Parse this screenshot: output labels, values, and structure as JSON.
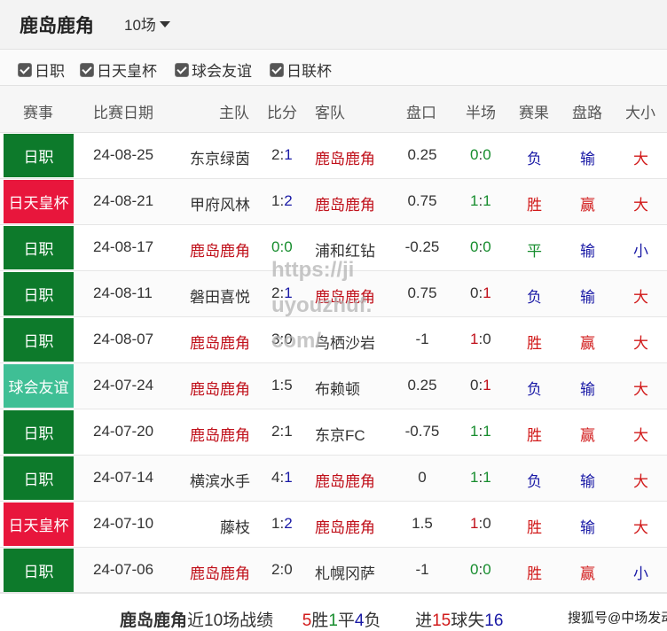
{
  "header": {
    "team": "鹿岛鹿角",
    "count": "10场"
  },
  "filters": [
    {
      "label": "日职",
      "checked": true
    },
    {
      "label": "日天皇杯",
      "checked": true
    },
    {
      "label": "球会友谊",
      "checked": true
    },
    {
      "label": "日联杯",
      "checked": true
    }
  ],
  "columns": [
    "赛事",
    "比赛日期",
    "主队",
    "比分",
    "客队",
    "盘口",
    "半场",
    "赛果",
    "盘路",
    "大小"
  ],
  "colors": {
    "j1": "#0d7a2b",
    "emperor": "#e8163c",
    "friendly": "#3fbf95",
    "team": "#c0101a",
    "win": "#d11919",
    "lose": "#1a1aa6",
    "draw": "#178d2e"
  },
  "rows": [
    {
      "league": "日职",
      "league_type": "j1",
      "date": "24-08-25",
      "home": "东京绿茵",
      "score_home": "2",
      "score_away": "1",
      "away": "鹿岛鹿角",
      "line": "0.25",
      "half_home": "0",
      "half_away": "0",
      "result": "负",
      "handicap": "输",
      "ou": "大"
    },
    {
      "league": "日天皇杯",
      "league_type": "emperor",
      "date": "24-08-21",
      "home": "甲府风林",
      "score_home": "1",
      "score_away": "2",
      "away": "鹿岛鹿角",
      "line": "0.75",
      "half_home": "1",
      "half_away": "1",
      "result": "胜",
      "handicap": "赢",
      "ou": "大"
    },
    {
      "league": "日职",
      "league_type": "j1",
      "date": "24-08-17",
      "home": "鹿岛鹿角",
      "score_home": "0",
      "score_away": "0",
      "away": "浦和红钻",
      "line": "-0.25",
      "half_home": "0",
      "half_away": "0",
      "result": "平",
      "handicap": "输",
      "ou": "小"
    },
    {
      "league": "日职",
      "league_type": "j1",
      "date": "24-08-11",
      "home": "磐田喜悦",
      "score_home": "2",
      "score_away": "1",
      "away": "鹿岛鹿角",
      "line": "0.75",
      "half_home": "0",
      "half_away": "1",
      "result": "负",
      "handicap": "输",
      "ou": "大"
    },
    {
      "league": "日职",
      "league_type": "j1",
      "date": "24-08-07",
      "home": "鹿岛鹿角",
      "score_home": "3",
      "score_away": "0",
      "away": "鸟栖沙岩",
      "line": "-1",
      "half_home": "1",
      "half_away": "0",
      "result": "胜",
      "handicap": "赢",
      "ou": "大"
    },
    {
      "league": "球会友谊",
      "league_type": "friendly",
      "date": "24-07-24",
      "home": "鹿岛鹿角",
      "score_home": "1",
      "score_away": "5",
      "away": "布赖顿",
      "line": "0.25",
      "half_home": "0",
      "half_away": "1",
      "result": "负",
      "handicap": "输",
      "ou": "大"
    },
    {
      "league": "日职",
      "league_type": "j1",
      "date": "24-07-20",
      "home": "鹿岛鹿角",
      "score_home": "2",
      "score_away": "1",
      "away": "东京FC",
      "line": "-0.75",
      "half_home": "1",
      "half_away": "1",
      "result": "胜",
      "handicap": "赢",
      "ou": "大"
    },
    {
      "league": "日职",
      "league_type": "j1",
      "date": "24-07-14",
      "home": "横滨水手",
      "score_home": "4",
      "score_away": "1",
      "away": "鹿岛鹿角",
      "line": "0",
      "half_home": "1",
      "half_away": "1",
      "result": "负",
      "handicap": "输",
      "ou": "大"
    },
    {
      "league": "日天皇杯",
      "league_type": "emperor",
      "date": "24-07-10",
      "home": "藤枝",
      "score_home": "1",
      "score_away": "2",
      "away": "鹿岛鹿角",
      "line": "1.5",
      "half_home": "1",
      "half_away": "0",
      "result": "胜",
      "handicap": "输",
      "ou": "大"
    },
    {
      "league": "日职",
      "league_type": "j1",
      "date": "24-07-06",
      "home": "鹿岛鹿角",
      "score_home": "2",
      "score_away": "0",
      "away": "札幌冈萨",
      "line": "-1",
      "half_home": "0",
      "half_away": "0",
      "result": "胜",
      "handicap": "赢",
      "ou": "小"
    }
  ],
  "footer": {
    "team": "鹿岛鹿角",
    "label": "近10场战绩",
    "wins": "5",
    "win_label": "胜",
    "draws": "1",
    "draw_label": "平",
    "losses": "4",
    "loss_label": "负",
    "goals_for_label": "进",
    "goals_for": "15",
    "goals_label": "球",
    "goals_against_label": "失",
    "goals_against": "16",
    "watermark": "搜狐号@中场发动机"
  },
  "overlay_text": [
    "https://ji",
    "uyouzhuf.",
    "com/"
  ]
}
